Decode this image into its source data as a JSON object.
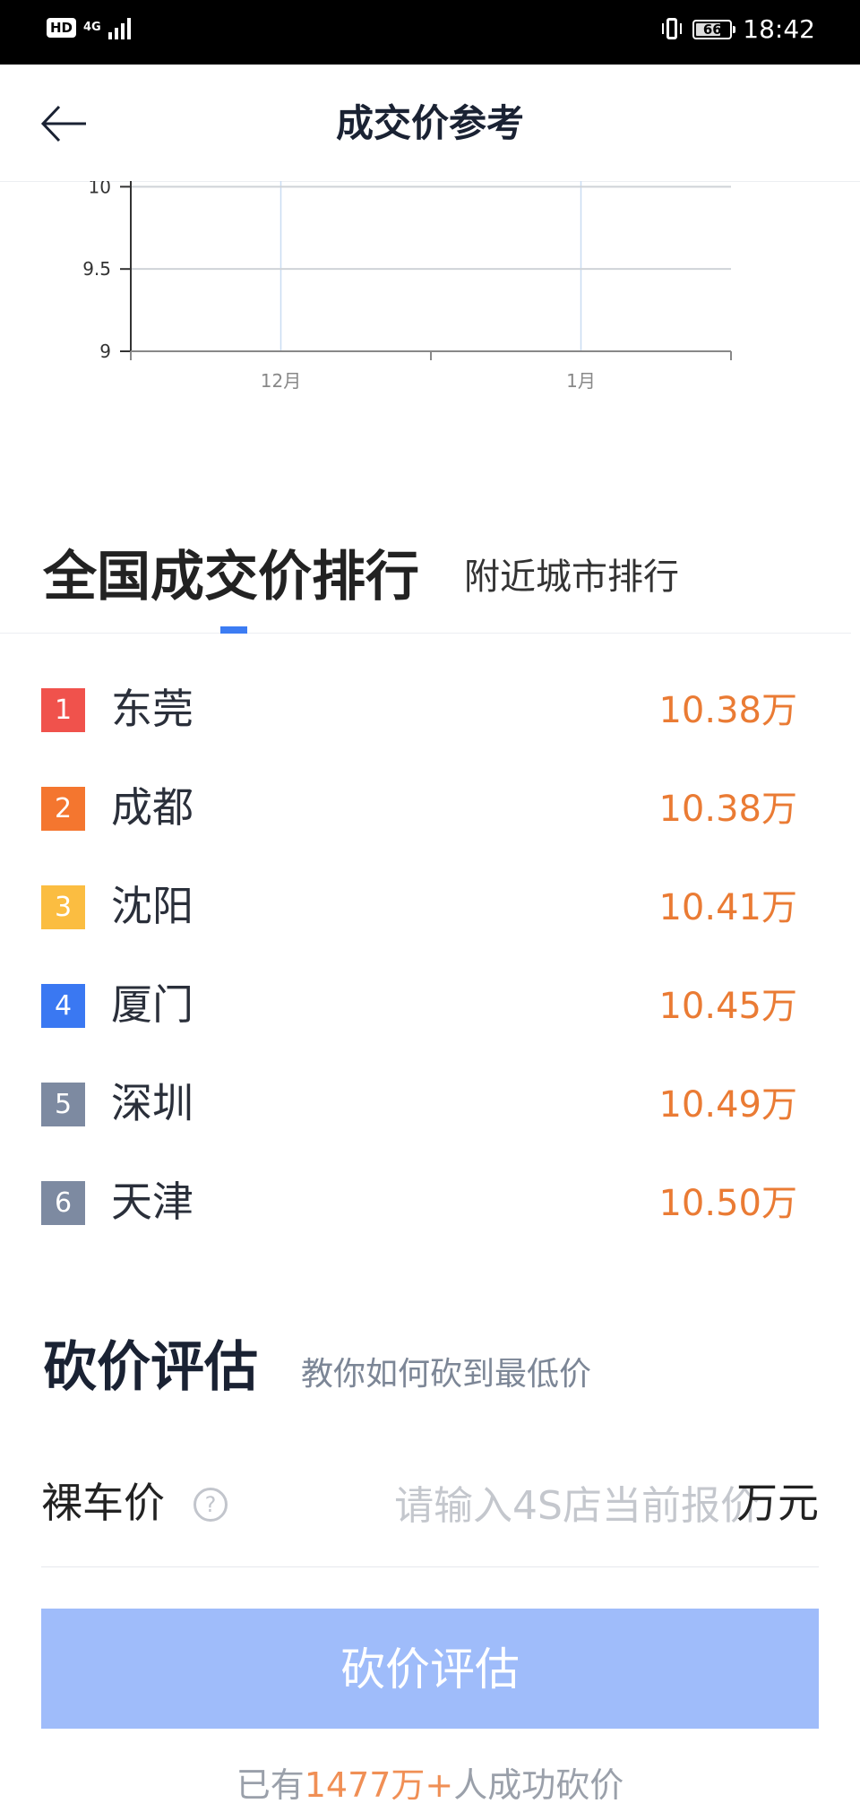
{
  "status_bar": {
    "hd": "HD",
    "network": "4G",
    "battery": "66",
    "time": "18:42"
  },
  "header": {
    "title": "成交价参考",
    "back_icon": "arrow-left-icon"
  },
  "chart_data": {
    "type": "line",
    "title": "",
    "xlabel": "",
    "ylabel": "",
    "yticks": [
      "9",
      "9.5",
      "10"
    ],
    "ylim": [
      9,
      10.1
    ],
    "xticks": [
      "12月",
      "1月"
    ],
    "grid": true,
    "series": []
  },
  "ranking": {
    "tab_active": "全国成交价排行",
    "tab_inactive": "附近城市排行",
    "items": [
      {
        "rank": "1",
        "city": "东莞",
        "price": "10.38万",
        "color": "#f0524c"
      },
      {
        "rank": "2",
        "city": "成都",
        "price": "10.38万",
        "color": "#f4762f"
      },
      {
        "rank": "3",
        "city": "沈阳",
        "price": "10.41万",
        "color": "#fbbd41"
      },
      {
        "rank": "4",
        "city": "厦门",
        "price": "10.45万",
        "color": "#3a78f2"
      },
      {
        "rank": "5",
        "city": "深圳",
        "price": "10.49万",
        "color": "#7d8aa1"
      },
      {
        "rank": "6",
        "city": "天津",
        "price": "10.50万",
        "color": "#7d8aa1"
      }
    ]
  },
  "bargain": {
    "title": "砍价评估",
    "subtitle": "教你如何砍到最低价",
    "price_label": "裸车价",
    "help_icon": "question-circle-icon",
    "help_glyph": "?",
    "input_placeholder": "请输入4S店当前报价",
    "unit": "万元",
    "button_label": "砍价评估",
    "footer_prefix": "已有",
    "footer_count": "1477万+",
    "footer_suffix": "人成功砍价"
  },
  "colors": {
    "accent": "#3c7cf3",
    "price": "#ea7b34",
    "button": "#9fbcfa"
  }
}
